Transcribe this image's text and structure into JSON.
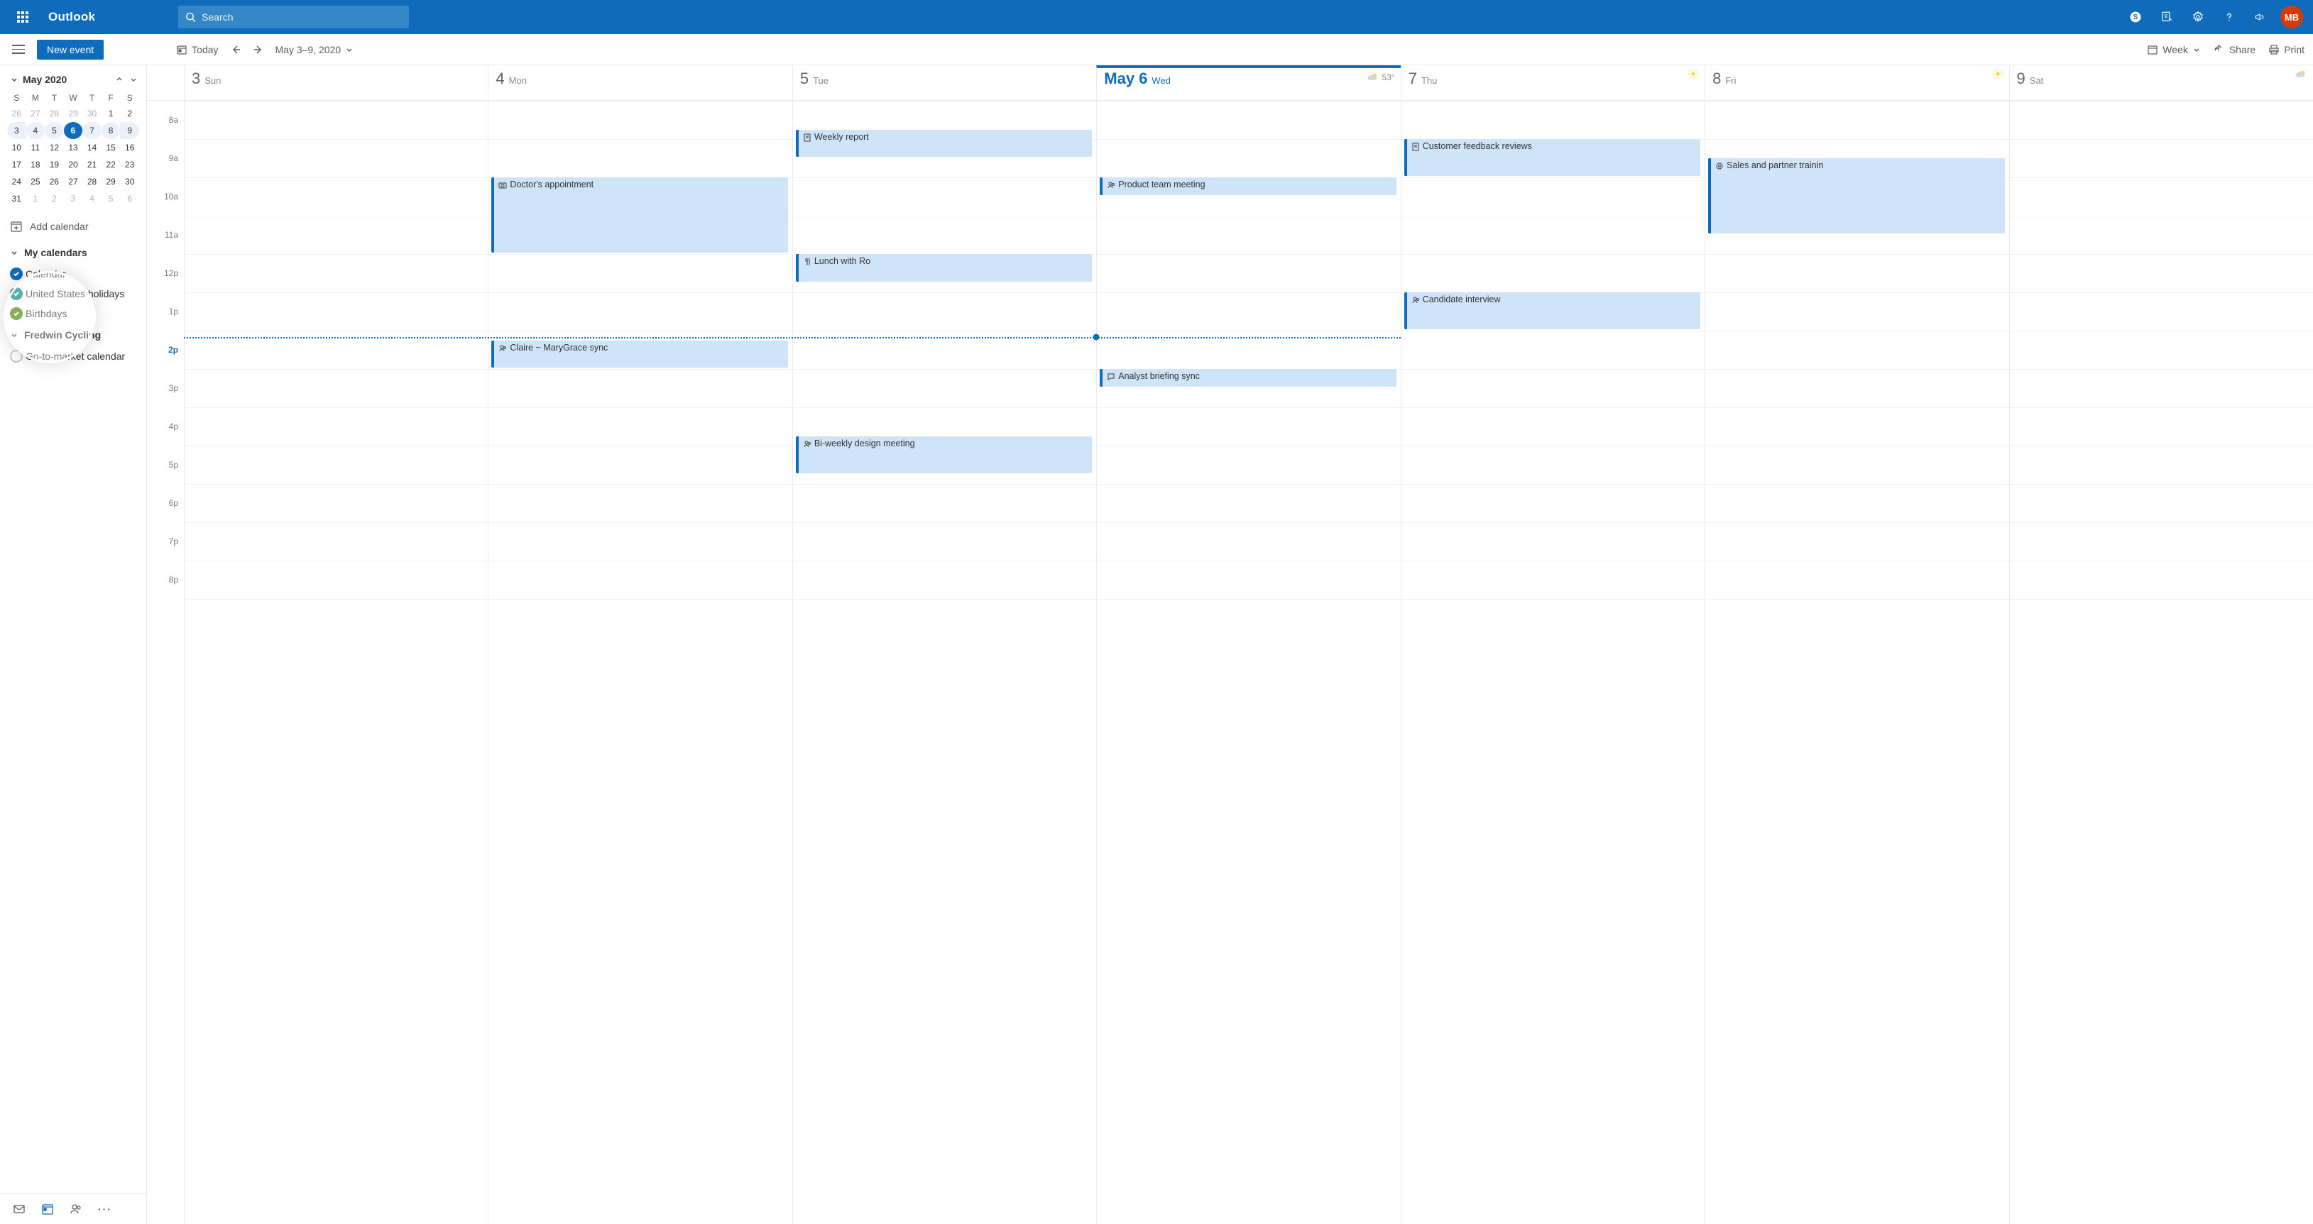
{
  "header": {
    "brand": "Outlook",
    "search_placeholder": "Search",
    "avatar_initials": "MB"
  },
  "toolbar": {
    "new_event": "New event",
    "today": "Today",
    "date_range": "May 3–9, 2020",
    "view": "Week",
    "share": "Share",
    "print": "Print"
  },
  "sidebar": {
    "month_label": "May 2020",
    "dow": [
      "S",
      "M",
      "T",
      "W",
      "T",
      "F",
      "S"
    ],
    "rows": [
      [
        "26",
        "27",
        "28",
        "29",
        "30",
        "1",
        "2"
      ],
      [
        "3",
        "4",
        "5",
        "6",
        "7",
        "8",
        "9"
      ],
      [
        "10",
        "11",
        "12",
        "13",
        "14",
        "15",
        "16"
      ],
      [
        "17",
        "18",
        "19",
        "20",
        "21",
        "22",
        "23"
      ],
      [
        "24",
        "25",
        "26",
        "27",
        "28",
        "29",
        "30"
      ],
      [
        "31",
        "1",
        "2",
        "3",
        "4",
        "5",
        "6"
      ]
    ],
    "add_calendar": "Add calendar",
    "group1": "My calendars",
    "cal1": "Calendar",
    "cal2": "United States holidays",
    "cal3": "Birthdays",
    "group2": "Fredwin Cycling",
    "cal4": "Go-to-market calendar"
  },
  "dayheads": [
    {
      "num": "3",
      "dow": "Sun"
    },
    {
      "num": "4",
      "dow": "Mon"
    },
    {
      "num": "5",
      "dow": "Tue"
    },
    {
      "num": "May 6",
      "dow": "Wed",
      "today": true,
      "weather": "53°"
    },
    {
      "num": "7",
      "dow": "Thu"
    },
    {
      "num": "8",
      "dow": "Fri"
    },
    {
      "num": "9",
      "dow": "Sat"
    }
  ],
  "times": [
    "8a",
    "9a",
    "10a",
    "11a",
    "12p",
    "1p",
    "2p",
    "3p",
    "4p",
    "5p",
    "6p",
    "7p",
    "8p"
  ],
  "events": {
    "weekly_report": "Weekly report",
    "doctor": "Doctor's appointment",
    "lunch": "Lunch with Ro",
    "claire": "Claire ~ MaryGrace sync",
    "design": "Bi-weekly design meeting",
    "product": "Product team meeting",
    "analyst": "Analyst briefing sync",
    "feedback": "Customer feedback reviews",
    "candidate": "Candidate interview",
    "sales": "Sales and partner trainin"
  }
}
